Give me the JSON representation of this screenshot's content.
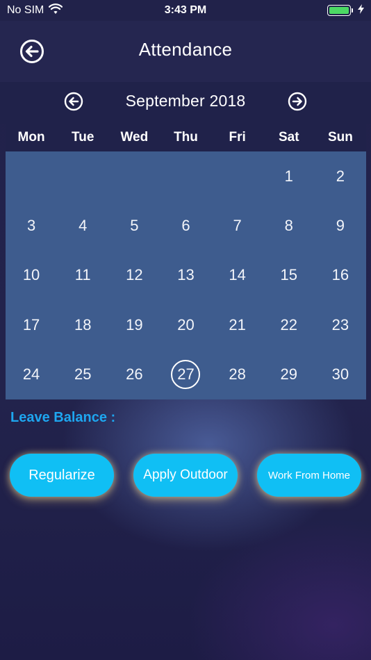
{
  "status_bar": {
    "carrier": "No SIM",
    "time": "3:43 PM"
  },
  "header": {
    "title": "Attendance"
  },
  "calendar": {
    "month_label": "September 2018",
    "weekdays": [
      "Mon",
      "Tue",
      "Wed",
      "Thu",
      "Fri",
      "Sat",
      "Sun"
    ],
    "weeks": [
      [
        "",
        "",
        "",
        "",
        "",
        "1",
        "2"
      ],
      [
        "3",
        "4",
        "5",
        "6",
        "7",
        "8",
        "9"
      ],
      [
        "10",
        "11",
        "12",
        "13",
        "14",
        "15",
        "16"
      ],
      [
        "17",
        "18",
        "19",
        "20",
        "21",
        "22",
        "23"
      ],
      [
        "24",
        "25",
        "26",
        "27",
        "28",
        "29",
        "30"
      ]
    ],
    "selected_day": "27"
  },
  "leave_balance": {
    "label": "Leave Balance :"
  },
  "actions": {
    "regularize": "Regularize",
    "apply_outdoor": "Apply Outdoor",
    "work_from_home": "Work From Home"
  },
  "colors": {
    "background": "#21224a",
    "calendar_bg": "#3e5c8e",
    "accent": "#10bff4",
    "leave_label": "#1ea6f0",
    "battery": "#4cd964"
  },
  "icons": {
    "back": "arrow-left-circle-icon",
    "prev_month": "arrow-left-circle-icon",
    "next_month": "arrow-right-circle-icon",
    "wifi": "wifi-icon",
    "battery": "battery-icon",
    "charging": "charging-bolt-icon"
  }
}
